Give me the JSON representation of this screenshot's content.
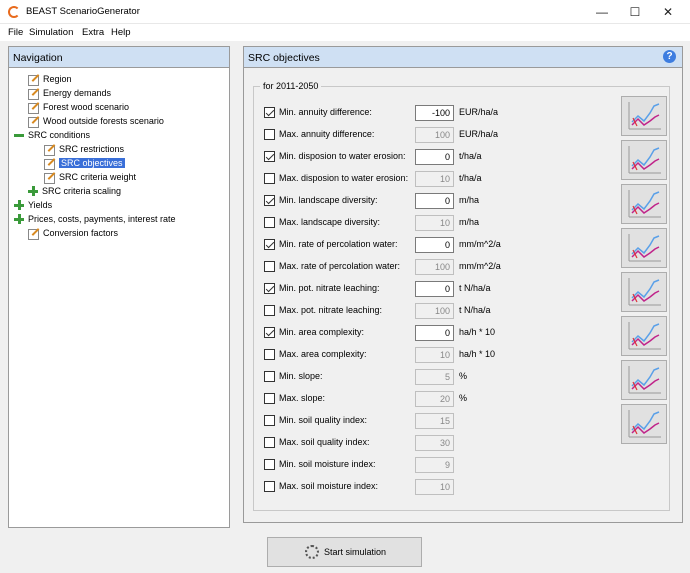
{
  "window": {
    "title": "BEAST ScenarioGenerator",
    "controls": [
      "—",
      "☐",
      "✕"
    ]
  },
  "menu": [
    "File",
    "Simulation",
    "Extra",
    "Help"
  ],
  "navigation": {
    "header": "Navigation",
    "items": [
      {
        "label": "Region",
        "icon": "pencil-icon",
        "level": 1,
        "selected": false
      },
      {
        "label": "Energy demands",
        "icon": "pencil-icon",
        "level": 1,
        "selected": false
      },
      {
        "label": "Forest wood scenario",
        "icon": "pencil-icon",
        "level": 1,
        "selected": false
      },
      {
        "label": "Wood outside forests scenario",
        "icon": "pencil-icon",
        "level": 1,
        "selected": false
      },
      {
        "label": "SRC conditions",
        "icon": "collapse-icon",
        "level": 0,
        "selected": false
      },
      {
        "label": "SRC restrictions",
        "icon": "pencil-icon",
        "level": 2,
        "selected": false
      },
      {
        "label": "SRC objectives",
        "icon": "pencil-icon",
        "level": 2,
        "selected": true
      },
      {
        "label": "SRC criteria weight",
        "icon": "pencil-icon",
        "level": 2,
        "selected": false
      },
      {
        "label": "SRC criteria scaling",
        "icon": "expand-icon",
        "level": 1,
        "selected": false
      },
      {
        "label": "Yields",
        "icon": "expand-icon",
        "level": 0,
        "selected": false
      },
      {
        "label": "Prices, costs, payments, interest rate",
        "icon": "expand-icon",
        "level": 0,
        "selected": false
      },
      {
        "label": "Conversion factors",
        "icon": "pencil-icon",
        "level": 1,
        "selected": false
      }
    ]
  },
  "main": {
    "header": "SRC objectives",
    "group_title": "for 2011-2050",
    "rows": [
      {
        "label": "Min. annuity difference:",
        "checked": true,
        "value": "-100",
        "unit": "EUR/ha/a"
      },
      {
        "label": "Max. annuity difference:",
        "checked": false,
        "value": "100",
        "unit": "EUR/ha/a"
      },
      {
        "label": "Min. disposion to water erosion:",
        "checked": true,
        "value": "0",
        "unit": "t/ha/a"
      },
      {
        "label": "Max. disposion to water erosion:",
        "checked": false,
        "value": "10",
        "unit": "t/ha/a"
      },
      {
        "label": "Min. landscape diversity:",
        "checked": true,
        "value": "0",
        "unit": "m/ha"
      },
      {
        "label": "Max. landscape diversity:",
        "checked": false,
        "value": "10",
        "unit": "m/ha"
      },
      {
        "label": "Min. rate of percolation water:",
        "checked": true,
        "value": "0",
        "unit": "mm/m^2/a"
      },
      {
        "label": "Max. rate of percolation water:",
        "checked": false,
        "value": "100",
        "unit": "mm/m^2/a"
      },
      {
        "label": "Min. pot. nitrate leaching:",
        "checked": true,
        "value": "0",
        "unit": "t N/ha/a"
      },
      {
        "label": "Max. pot. nitrate leaching:",
        "checked": false,
        "value": "100",
        "unit": "t N/ha/a"
      },
      {
        "label": "Min. area complexity:",
        "checked": true,
        "value": "0",
        "unit": "ha/h * 10"
      },
      {
        "label": "Max. area complexity:",
        "checked": false,
        "value": "10",
        "unit": "ha/h * 10"
      },
      {
        "label": "Min. slope:",
        "checked": false,
        "value": "5",
        "unit": "%"
      },
      {
        "label": "Max. slope:",
        "checked": false,
        "value": "20",
        "unit": "%"
      },
      {
        "label": "Min. soil quality index:",
        "checked": false,
        "value": "15",
        "unit": ""
      },
      {
        "label": "Max. soil quality index:",
        "checked": false,
        "value": "30",
        "unit": ""
      },
      {
        "label": "Min. soil moisture index:",
        "checked": false,
        "value": "9",
        "unit": ""
      },
      {
        "label": "Max. soil moisture index:",
        "checked": false,
        "value": "10",
        "unit": ""
      }
    ],
    "chart_buttons_count": 8,
    "chart_colors": {
      "blue": "#5aa0e8",
      "magenta": "#c0248a",
      "red": "#e0303a"
    }
  },
  "start_button": {
    "label": "Start simulation",
    "icon": "settings-icon"
  }
}
